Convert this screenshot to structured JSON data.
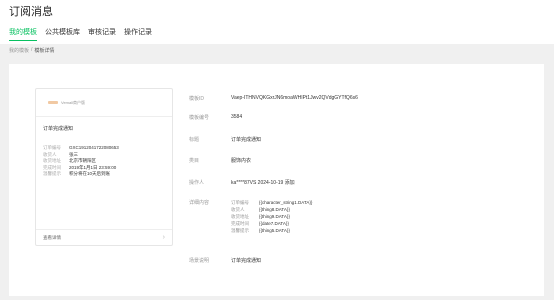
{
  "header": {
    "title": "订阅消息",
    "tabs": [
      "我的模板",
      "公共模板库",
      "审核记录",
      "操作记录"
    ]
  },
  "breadcrumb": {
    "parent": "我的模板",
    "separator": "/",
    "current": "模板详情"
  },
  "card": {
    "account": "Vemall商户版",
    "title": "订单完成通知",
    "fields": [
      {
        "label": "订单编号",
        "value": "GXC1912041722080653"
      },
      {
        "label": "收货人",
        "value": "张三"
      },
      {
        "label": "收货地址",
        "value": "北京市朝阳区"
      },
      {
        "label": "完成时间",
        "value": "2019年1月1日 23:59:00"
      },
      {
        "label": "温馨提示",
        "value": "积分将在10天后到账"
      }
    ],
    "footer": "查看详情"
  },
  "details": {
    "template_id_label": "模板ID",
    "template_id": "Vaep-ITHNVQKGxrJN6moaWHIPt1Jwv2QVdgGYTfQ6s6",
    "template_no_label": "模板编号",
    "template_no": "3584",
    "title_label": "标题",
    "title": "订单完成通知",
    "category_label": "类目",
    "category": "服饰内衣",
    "operator_label": "操作人",
    "operator": "ka****87VS 2024-10-19 添加",
    "content_label": "详细内容",
    "content": [
      {
        "label": "订单编号",
        "value": "{{character_string1.DATA}}"
      },
      {
        "label": "收货人",
        "value": "{{thing8.DATA}}"
      },
      {
        "label": "收货地址",
        "value": "{{thing9.DATA}}"
      },
      {
        "label": "完成时间",
        "value": "{{date7.DATA}}"
      },
      {
        "label": "温馨提示",
        "value": "{{thing5.DATA}}"
      }
    ],
    "scene_label": "场景说明",
    "scene": "订单完成通知"
  }
}
